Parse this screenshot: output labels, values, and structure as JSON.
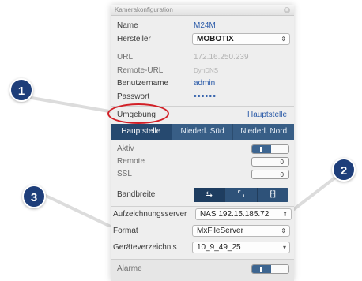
{
  "panel": {
    "title": "Kamerakonfiguration",
    "close_symbol": "⊗"
  },
  "fields": {
    "name_label": "Name",
    "name_value": "M24M",
    "hersteller_label": "Hersteller",
    "hersteller_value": "MOBOTIX",
    "url_label": "URL",
    "url_value": "172.16.250.239",
    "remote_url_label": "Remote-URL",
    "remote_url_value": "DynDNS",
    "benutzername_label": "Benutzername",
    "benutzername_value": "admin",
    "passwort_label": "Passwort",
    "passwort_value": "••••••"
  },
  "umgebung": {
    "label": "Umgebung",
    "value": "Hauptstelle",
    "tabs": [
      "Hauptstelle",
      "Niederl. Süd",
      "Niederl. Nord"
    ]
  },
  "toggles": {
    "aktiv_label": "Aktiv",
    "remote_label": "Remote",
    "remote_value": "0",
    "ssl_label": "SSL",
    "ssl_value": "0"
  },
  "bandbreite": {
    "label": "Bandbreite",
    "icons": [
      "camera-swap-icon",
      "frame-icon",
      "dotted-frame-icon"
    ]
  },
  "recording": {
    "server_label": "Aufzeichnungsserver",
    "server_value": "NAS 192.15.185.72",
    "format_label": "Format",
    "format_value": "MxFileServer",
    "dir_label": "Geräteverzeichnis",
    "dir_value": "10_9_49_25"
  },
  "alarme": {
    "label": "Alarme"
  },
  "callouts": [
    "1",
    "2",
    "3"
  ],
  "colors": {
    "accent": "#385e86",
    "callout": "#1e3e7a",
    "highlight": "#d21f26",
    "link": "#2a5aa8"
  }
}
